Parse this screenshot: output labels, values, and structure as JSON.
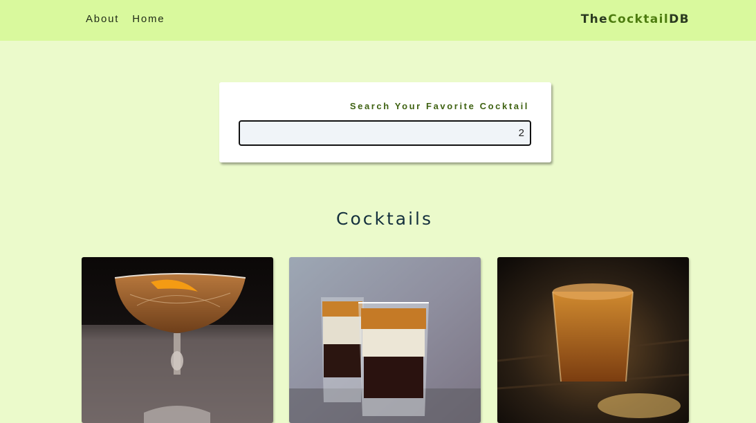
{
  "nav": {
    "links": [
      "About",
      "Home"
    ],
    "logo_prefix": "The",
    "logo_main": "Cocktail",
    "logo_suffix": "DB"
  },
  "search": {
    "label": "Search Your Favorite Cocktail",
    "value": "2"
  },
  "section": {
    "title": "Cocktails"
  },
  "cards": [
    {
      "image": "coupe-glass-cocktail-photo"
    },
    {
      "image": "layered-shot-glasses-photo"
    },
    {
      "image": "whiskey-shot-glass-photo"
    }
  ]
}
